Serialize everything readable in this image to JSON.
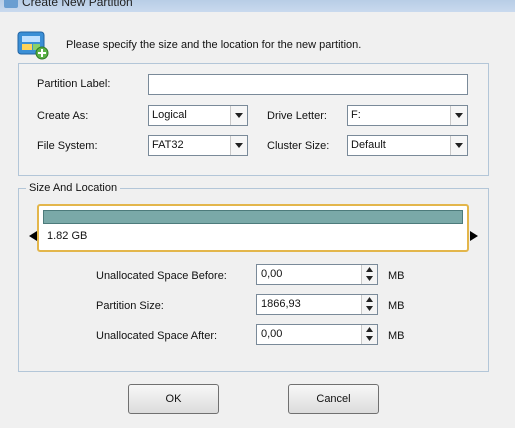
{
  "window": {
    "title": "Create New Partition"
  },
  "header": {
    "instruction": "Please specify the size and the location for the new partition."
  },
  "form": {
    "partition_label": {
      "label": "Partition Label:",
      "value": ""
    },
    "create_as": {
      "label": "Create As:",
      "value": "Logical"
    },
    "drive_letter": {
      "label": "Drive Letter:",
      "value": "F:"
    },
    "file_system": {
      "label": "File System:",
      "value": "FAT32"
    },
    "cluster_size": {
      "label": "Cluster Size:",
      "value": "Default"
    }
  },
  "size_location": {
    "legend": "Size And Location",
    "bar_size": "1.82 GB",
    "fields": [
      {
        "label": "Unallocated Space Before:",
        "value": "0,00",
        "unit": "MB"
      },
      {
        "label": "Partition Size:",
        "value": "1866,93",
        "unit": "MB"
      },
      {
        "label": "Unallocated Space After:",
        "value": "0,00",
        "unit": "MB"
      }
    ]
  },
  "buttons": {
    "ok": "OK",
    "cancel": "Cancel"
  },
  "icons": {
    "header": "partition-wizard-icon",
    "dropdown": "chevron-down-icon"
  }
}
